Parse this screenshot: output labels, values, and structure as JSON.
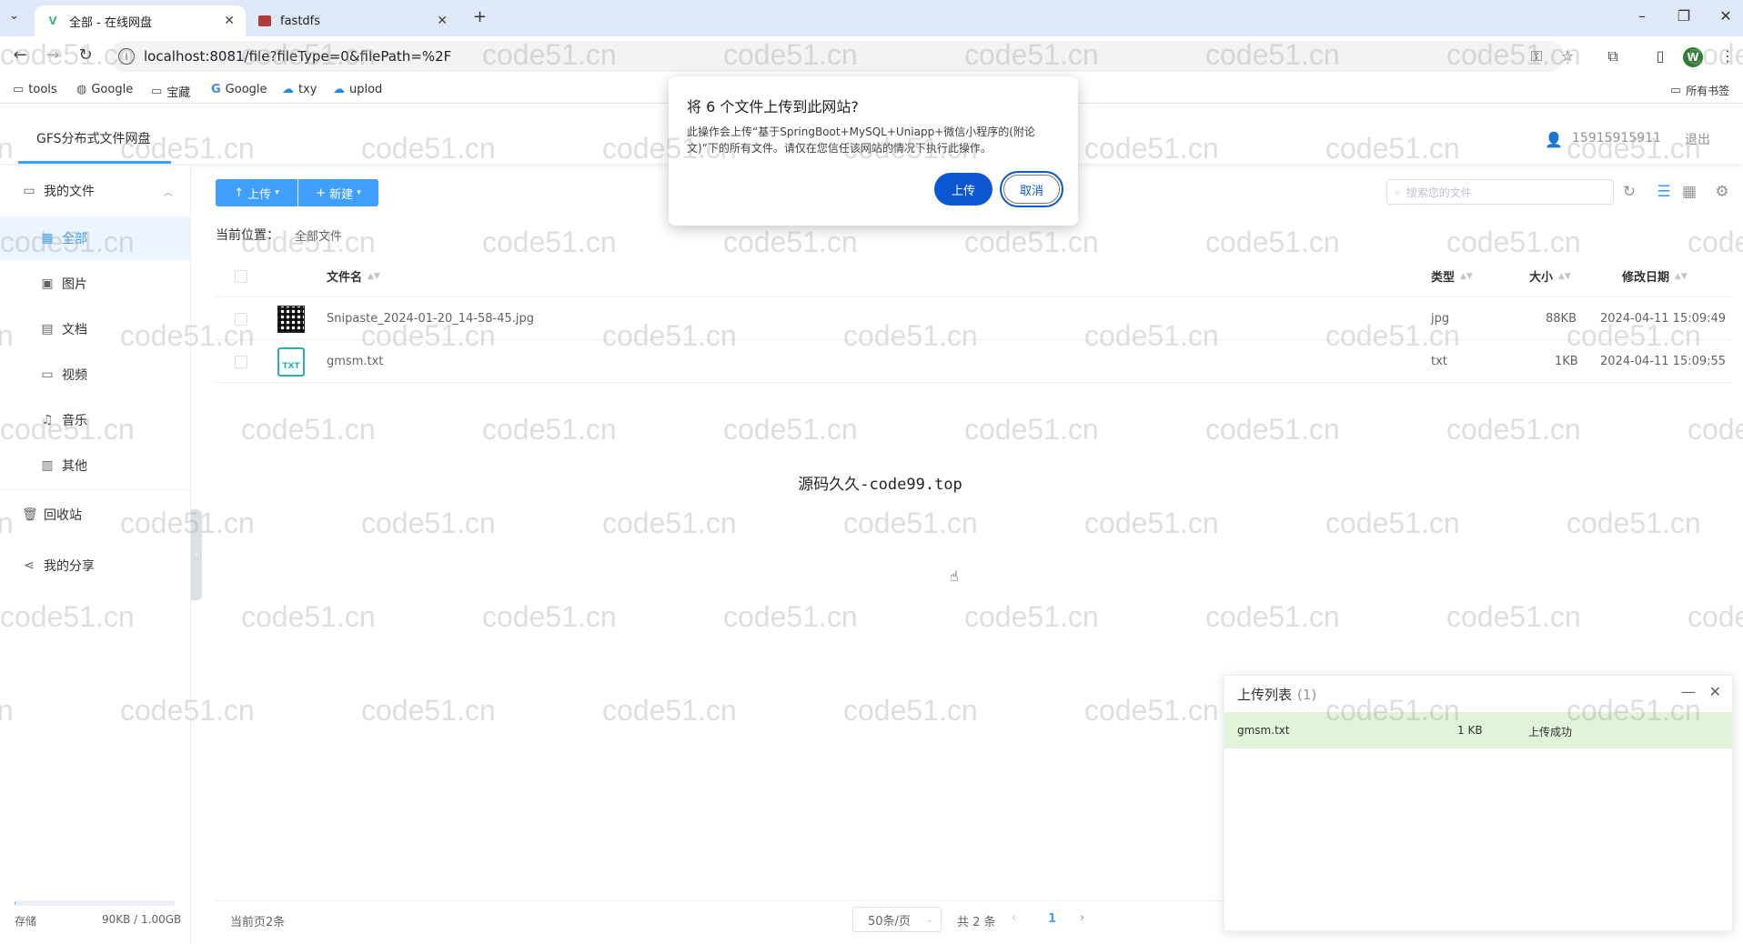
{
  "browser": {
    "tabs": [
      {
        "title": "全部 - 在线网盘",
        "active": true
      },
      {
        "title": "fastdfs",
        "active": false
      }
    ],
    "new_tab": "+",
    "url": "localhost:8081/file?fileType=0&filePath=%2F",
    "bookmarks": [
      "tools",
      "Google",
      "宝藏",
      "Google",
      "txy",
      "uplod"
    ],
    "all_bookmarks": "所有书签",
    "profile_initial": "W"
  },
  "app": {
    "logo": "GFS分布式文件网盘",
    "user": "15915915911",
    "logout": "退出"
  },
  "sidebar": {
    "my_files": "我的文件",
    "items": [
      {
        "label": "全部",
        "icon": "grid-icon",
        "active": true
      },
      {
        "label": "图片",
        "icon": "image-icon",
        "active": false
      },
      {
        "label": "文档",
        "icon": "document-icon",
        "active": false
      },
      {
        "label": "视频",
        "icon": "video-icon",
        "active": false
      },
      {
        "label": "音乐",
        "icon": "headphones-icon",
        "active": false
      },
      {
        "label": "其他",
        "icon": "box-icon",
        "active": false
      }
    ],
    "recycle": "回收站",
    "share": "我的分享",
    "storage_label": "存储",
    "storage_value": "90KB / 1.00GB",
    "storage_fraction": 0.0001
  },
  "toolbar": {
    "upload": "上传",
    "create": "新建",
    "search_placeholder": "搜索您的文件"
  },
  "breadcrumb": {
    "label": "当前位置：",
    "value": "全部文件"
  },
  "table": {
    "columns": [
      "文件名",
      "类型",
      "大小",
      "修改日期"
    ],
    "rows": [
      {
        "name": "Snipaste_2024-01-20_14-58-45.jpg",
        "type": "jpg",
        "size": "88KB",
        "date": "2024-04-11 15:09:49",
        "thumb": "qr-image"
      },
      {
        "name": "gmsm.txt",
        "type": "txt",
        "size": "1KB",
        "date": "2024-04-11 15:09:55",
        "thumb": "txt-file"
      }
    ]
  },
  "center_text": "源码久久-code99.top",
  "pager": {
    "current_page_count": "当前页2条",
    "page_size": "50条/页",
    "total": "共 2 条",
    "page": "1"
  },
  "upload_panel": {
    "title": "上传列表",
    "count": "(1)",
    "item": {
      "name": "gmsm.txt",
      "size": "1 KB",
      "status": "上传成功"
    },
    "colors": {
      "success_bg": "#e1f3d8"
    }
  },
  "dialog": {
    "title": "将 6 个文件上传到此网站?",
    "body": "此操作会上传“基于SpringBoot+MySQL+Uniapp+微信小程序的(附论文)”下的所有文件。请仅在您信任该网站的情况下执行此操作。",
    "confirm": "上传",
    "cancel": "取消"
  },
  "watermark": "code51.cn",
  "colors": {
    "accent": "#409eff",
    "dialog_primary": "#0b57d0"
  }
}
